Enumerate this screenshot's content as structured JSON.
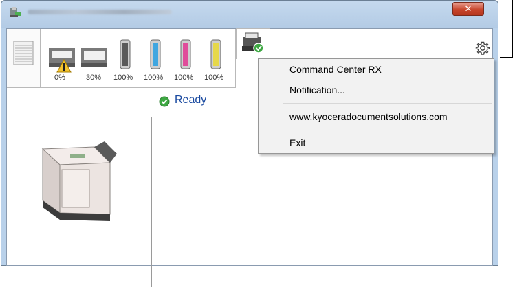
{
  "window": {
    "close_icon": "close-icon",
    "close_color": "#c7452c"
  },
  "toolbar": {
    "trays": [
      {
        "name": "paper-tray-cassette-1",
        "value": "0%",
        "warning": true
      },
      {
        "name": "paper-tray-cassette-2",
        "value": "30%",
        "warning": false
      }
    ],
    "toners": [
      {
        "color": "black",
        "hex": "#5a5a5a",
        "value": "100%"
      },
      {
        "color": "cyan",
        "hex": "#3fa6e0",
        "value": "100%"
      },
      {
        "color": "magenta",
        "hex": "#e04c9a",
        "value": "100%"
      },
      {
        "color": "yellow",
        "hex": "#e6d84a",
        "value": "100%"
      }
    ],
    "settings_icon": "gear-icon"
  },
  "status": {
    "text": "Ready",
    "color": "#1a4aa0"
  },
  "menu": {
    "items": [
      {
        "label": "Command Center RX"
      },
      {
        "label": "Notification..."
      },
      {
        "label": "www.kyoceradocumentsolutions.com"
      },
      {
        "label": "Exit"
      }
    ]
  }
}
